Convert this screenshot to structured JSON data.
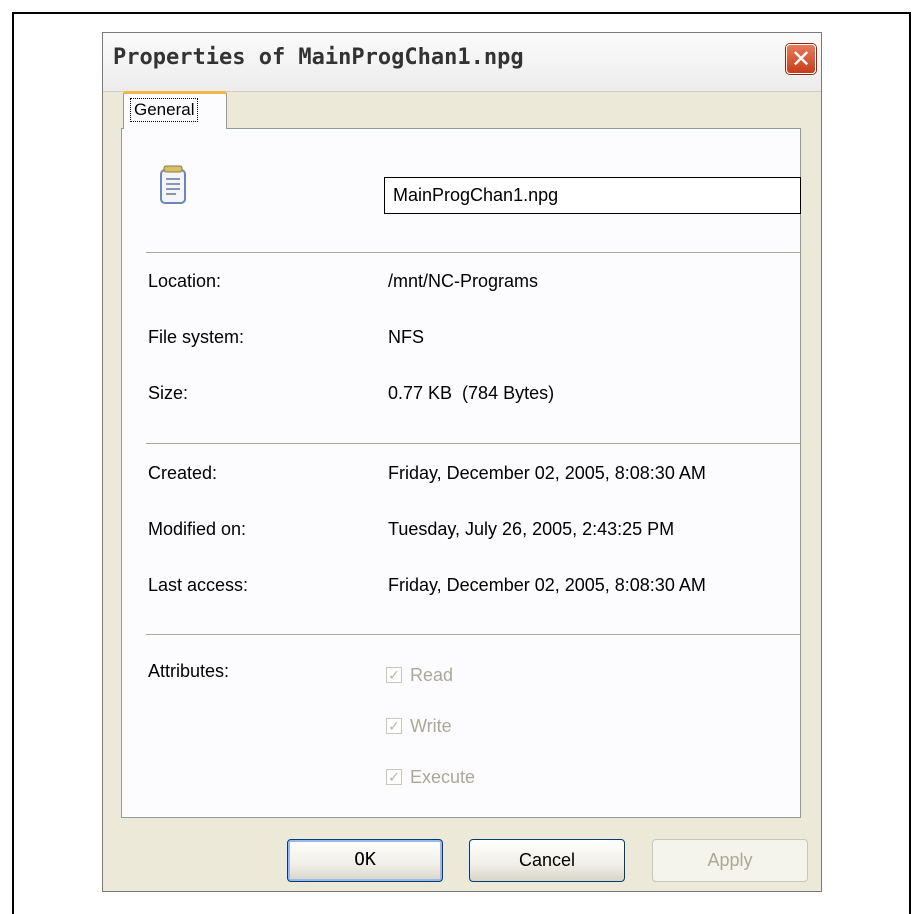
{
  "window": {
    "title": "Properties of MainProgChan1.npg",
    "close_glyph": "✕"
  },
  "tabs": [
    {
      "label": "General",
      "active": true
    }
  ],
  "file": {
    "icon": "text-document-icon",
    "name": "MainProgChan1.npg"
  },
  "info": {
    "location_label": "Location:",
    "location_value": "/mnt/NC-Programs",
    "filesystem_label": "File system:",
    "filesystem_value": "NFS",
    "size_label": "Size:",
    "size_value": "0.77 KB  (784 Bytes)",
    "created_label": "Created:",
    "created_value": "Friday, December 02, 2005, 8:08:30 AM",
    "modified_label": "Modified on:",
    "modified_value": "Tuesday, July 26, 2005, 2:43:25 PM",
    "access_label": "Last access:",
    "access_value": "Friday, December 02, 2005, 8:08:30 AM"
  },
  "attributes": {
    "label": "Attributes:",
    "read": {
      "label": "Read",
      "checked": true,
      "enabled": false
    },
    "write": {
      "label": "Write",
      "checked": true,
      "enabled": false
    },
    "execute": {
      "label": "Execute",
      "checked": true,
      "enabled": false
    }
  },
  "buttons": {
    "ok": "OK",
    "cancel": "Cancel",
    "apply": "Apply"
  },
  "colors": {
    "tab_accent": "#f2b443",
    "close_button": "#c63d1c",
    "dialog_bg": "#ece9d8"
  }
}
